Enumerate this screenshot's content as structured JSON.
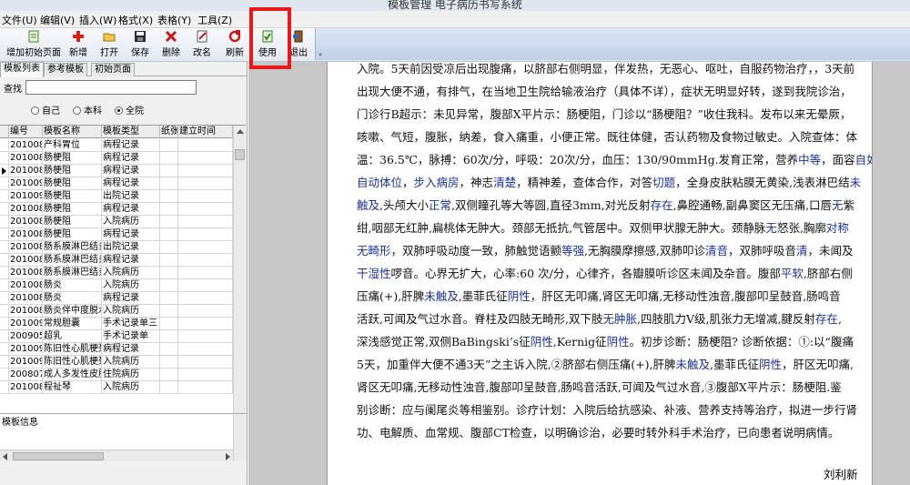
{
  "window": {
    "title": "模板管理  电子病历书写系统"
  },
  "menu": [
    "文件(U)",
    "编辑(V)",
    "插入(W)",
    "格式(X)",
    "表格(Y)",
    "工具(Z)"
  ],
  "toolbar": {
    "buttons": [
      {
        "label": "增加初始页面",
        "icon": "add-page-icon"
      },
      {
        "label": "新增",
        "icon": "new-icon"
      },
      {
        "label": "打开",
        "icon": "open-folder-icon"
      },
      {
        "label": "保存",
        "icon": "save-icon"
      },
      {
        "label": "删除",
        "icon": "delete-icon"
      },
      {
        "label": "改名",
        "icon": "rename-icon"
      },
      {
        "label": "刷新",
        "icon": "refresh-icon"
      },
      {
        "label": "使用",
        "icon": "use-icon"
      },
      {
        "label": "退出",
        "icon": "exit-icon"
      }
    ],
    "overflow": "»"
  },
  "left_panel": {
    "tabs": [
      "模板列表",
      "参考模板",
      "初始页面"
    ],
    "search_label": "查找",
    "search_value": "",
    "radios": [
      {
        "label": "自己",
        "checked": false
      },
      {
        "label": "本科",
        "checked": false
      },
      {
        "label": "全院",
        "checked": true
      }
    ],
    "columns": [
      "编号",
      "模板名称",
      "模板类型",
      "纸张",
      "建立时间"
    ],
    "rows": [
      [
        "2010081",
        "产科胃位",
        "病程记录",
        "",
        ""
      ],
      [
        "2010081",
        "肠梗阻",
        "病程记录",
        "",
        ""
      ],
      [
        "2010081",
        "肠梗阻",
        "病程记录",
        "",
        ""
      ],
      [
        "2010090",
        "肠梗阻",
        "病程记录",
        "",
        ""
      ],
      [
        "2010090",
        "肠梗阻",
        "出院记录",
        "",
        ""
      ],
      [
        "2010082",
        "肠梗阻",
        "病程记录",
        "",
        ""
      ],
      [
        "2010081",
        "肠梗阻",
        "入院病历",
        "",
        ""
      ],
      [
        "2010081",
        "肠梗阻",
        "病程记录",
        "",
        ""
      ],
      [
        "2010083",
        "肠系膜淋巴结炎",
        "出院记录",
        "",
        ""
      ],
      [
        "2010083",
        "肠系膜淋巴结炎",
        "病程记录",
        "",
        ""
      ],
      [
        "2010083",
        "肠系膜淋巴结炎",
        "入院病历",
        "",
        ""
      ],
      [
        "2010082",
        "肠炎",
        "入院病历",
        "",
        ""
      ],
      [
        "2010082",
        "肠炎",
        "病程记录",
        "",
        ""
      ],
      [
        "2010082",
        "肠炎伴中度脱水",
        "入院病历",
        "",
        ""
      ],
      [
        "2010091",
        "常规胆囊",
        "手术记录单三",
        "",
        ""
      ],
      [
        "2009050",
        "超乳",
        "手术记录单",
        "",
        ""
      ],
      [
        "2010090",
        "陈旧性心肌梗死",
        "病程记录",
        "",
        ""
      ],
      [
        "2010090",
        "陈旧性心肌梗死",
        "入院病历",
        "",
        ""
      ],
      [
        "2008070",
        "成人多发性皮肌炎",
        "住院病历",
        "",
        ""
      ],
      [
        "2010082",
        "程祉琴",
        "入院病历",
        "",
        ""
      ]
    ],
    "selected_row": 2,
    "info_label": "模板信息"
  },
  "document": {
    "lines": [
      [
        "入院。5天前因受凉后出现腹痛，以脐部右侧明显，伴发热，无恶心、呕吐，自服药物治疗，，3天前"
      ],
      [
        "出现大便不通，有排气，在当地卫生院给输液治疗（具体不详），症状无明显好转，遂到我院诊治，"
      ],
      [
        "门诊行B超示：未见异常，腹部X平片示：肠梗阻，门诊以“肠梗阻？”收住我科。发布以来无晕厥，"
      ],
      [
        "咳嗽、气短，腹胀，纳差，食入痛重，小便正常。既往体健，否认药物及食物过敏史。入院查体：体"
      ],
      [
        "温：36.5℃，脉搏：60次/分，呼吸：20次/分，血压：130/90mmHg.发育正常，营养",
        {
          "b": "中等"
        },
        "，面容",
        {
          "b": "自如"
        },
        "，"
      ],
      [
        {
          "b": "自动体位"
        },
        "，",
        {
          "b": "步入病房"
        },
        "，神志",
        {
          "b": "清楚"
        },
        "，精神差，查体合作，对答",
        {
          "b": "切题"
        },
        "，全身皮肤粘膜无黄染,浅表淋巴结",
        {
          "b": "未"
        }
      ],
      [
        {
          "b": "触及"
        },
        ",头颅大小",
        {
          "b": "正常"
        },
        ",双侧瞳孔等大等圆,直径3mm,对光反射",
        {
          "b": "存在"
        },
        ",鼻腔通畅,副鼻窦区无压痛,口唇",
        {
          "b": "无"
        },
        "紫"
      ],
      [
        "绀,咽部无红肿,扁桃体无肿大。颈部无抵抗,气管居中。双侧甲状腺无肿大。颈静脉",
        {
          "b": "无"
        },
        "怒张,胸廓",
        {
          "b": "对称"
        }
      ],
      [
        {
          "b": "无畸形"
        },
        "，双肺呼吸动度一致，肺触觉语颤",
        {
          "b": "等强"
        },
        ",无胸膜摩擦感,双肺叩诊",
        {
          "b": "清音"
        },
        "，双肺呼吸音",
        {
          "b": "清"
        },
        "，未闻及"
      ],
      [
        {
          "b": "干湿性"
        },
        "啰音。心界无扩大，心率:60 次/分，心律齐，各瓣膜听诊区未闻及杂音。腹部",
        {
          "b": "平软"
        },
        ",脐部右侧"
      ],
      [
        "压痛(+),肝脾",
        {
          "b": "未触及"
        },
        ",墨菲氏征",
        {
          "b": "阴性"
        },
        "，肝区无叩痛,肾区无叩痛,无移动性浊音,腹部叩呈鼓音,肠鸣音"
      ],
      [
        "活跃,可闻及气过水音。脊柱及四肢无畸形,双下肢",
        {
          "b": "无肿胀"
        },
        ",四肢肌力Ⅴ级,肌张力无增减,腱反射",
        {
          "b": "存在"
        },
        ","
      ],
      [
        "深浅感觉正常,双侧BaBingski’s征",
        {
          "b": "阴性"
        },
        ",Kernig征",
        {
          "b": "阴性"
        },
        "。初步诊断：肠梗阻? 诊断依据：①:以“腹痛"
      ],
      [
        "5天，加重伴大便不通3天”之主诉入院,②脐部右侧压痛(+),肝脾",
        {
          "b": "未触及"
        },
        ",墨菲氏征",
        {
          "b": "阴性"
        },
        "，肝区无叩痛,"
      ],
      [
        "肾区无叩痛,无移动性浊音,腹部叩呈鼓音,肠鸣音活跃,可闻及气过水音,③腹部X平片示：肠梗阻.鉴"
      ],
      [
        "别诊断：应与阑尾炎等相鉴别。诊疗计划：入院后给抗感染、补液、营养支持等治疗，拟进一步行肾"
      ],
      [
        "功、电解质、血常规、腹部CT检查，以明确诊治，必要时转外科手术治疗，已向患者说明病情。"
      ]
    ],
    "signature": "刘利新"
  }
}
